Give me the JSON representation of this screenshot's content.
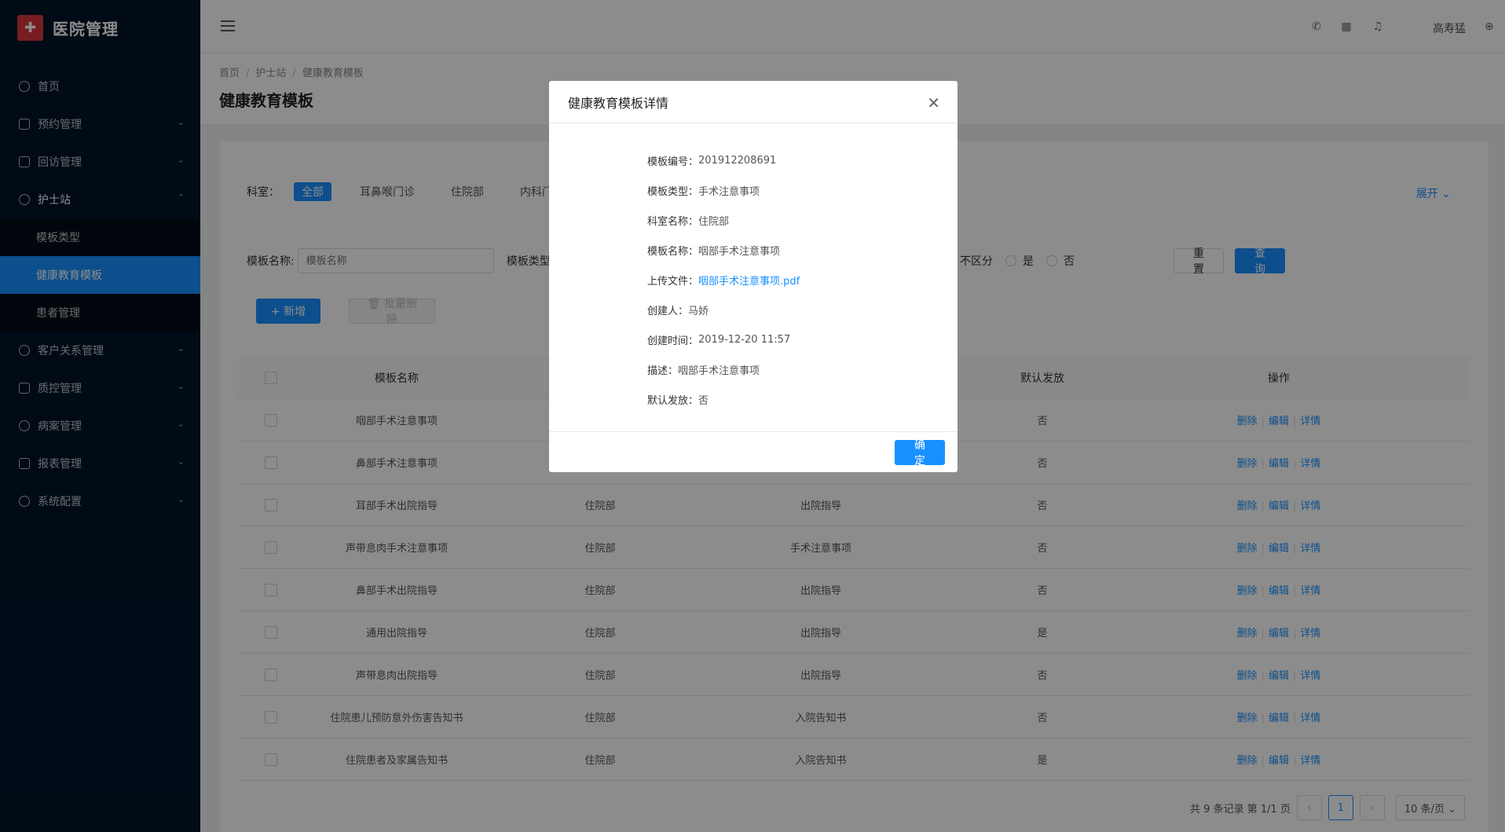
{
  "app": {
    "logo_glyph": "✚",
    "title": "医院管理"
  },
  "sidebar": {
    "items": [
      {
        "label": "首页",
        "icon": "dashboard-icon",
        "chevron": ""
      },
      {
        "label": "预约管理",
        "icon": "edit-icon",
        "chevron": "⌄"
      },
      {
        "label": "回访管理",
        "icon": "lock-icon",
        "chevron": "⌄"
      },
      {
        "label": "护士站",
        "icon": "user-icon",
        "chevron": "⌃"
      },
      {
        "label": "客户关系管理",
        "icon": "user-icon",
        "chevron": "⌄"
      },
      {
        "label": "质控管理",
        "icon": "table-icon",
        "chevron": "⌄"
      },
      {
        "label": "病案管理",
        "icon": "user-icon",
        "chevron": "⌄"
      },
      {
        "label": "报表管理",
        "icon": "edit-icon",
        "chevron": "⌄"
      },
      {
        "label": "系统配置",
        "icon": "dashboard-icon",
        "chevron": "⌄"
      }
    ],
    "sub_items": [
      {
        "label": "模板类型"
      },
      {
        "label": "健康教育模板"
      },
      {
        "label": "患者管理"
      }
    ]
  },
  "topbar": {
    "phone_glyph": "✆",
    "grid_glyph": "▦",
    "bell_glyph": "♫",
    "user": "高寿猛",
    "globe_glyph": "⊕"
  },
  "breadcrumb": {
    "items": [
      "首页",
      "护士站",
      "健康教育模板"
    ],
    "sep": "/"
  },
  "page_title": "健康教育模板",
  "filter": {
    "label": "科室：",
    "tags": [
      "全部",
      "耳鼻喉门诊",
      "住院部",
      "内科门诊"
    ],
    "expand": "展开 ⌄"
  },
  "search": {
    "name_label": "模板名称:",
    "name_placeholder": "模板名称",
    "type_label": "模板类型",
    "radio_label": "不区分",
    "radio_yes": "是",
    "radio_no": "否",
    "reset": "重 置",
    "query": "查 询"
  },
  "actions": {
    "add": "+ 新增",
    "batch_delete": "🗑 批量删除"
  },
  "table": {
    "headers": {
      "name": "模板名称",
      "dept": "",
      "type": "",
      "default": "默认发放",
      "op": "操作"
    },
    "op_labels": {
      "delete": "删除",
      "edit": "编辑",
      "detail": "详情",
      "sep": "|"
    },
    "rows": [
      {
        "name": "咽部手术注意事项",
        "dept": "",
        "type": "",
        "default": "否"
      },
      {
        "name": "鼻部手术注意事项",
        "dept": "",
        "type": "",
        "default": "否"
      },
      {
        "name": "耳部手术出院指导",
        "dept": "住院部",
        "type": "出院指导",
        "default": "否"
      },
      {
        "name": "声带息肉手术注意事项",
        "dept": "住院部",
        "type": "手术注意事项",
        "default": "否"
      },
      {
        "name": "鼻部手术出院指导",
        "dept": "住院部",
        "type": "出院指导",
        "default": "否"
      },
      {
        "name": "通用出院指导",
        "dept": "住院部",
        "type": "出院指导",
        "default": "是"
      },
      {
        "name": "声带息肉出院指导",
        "dept": "住院部",
        "type": "出院指导",
        "default": "否"
      },
      {
        "name": "住院患儿预防意外伤害告知书",
        "dept": "住院部",
        "type": "入院告知书",
        "default": "否"
      },
      {
        "name": "住院患者及家属告知书",
        "dept": "住院部",
        "type": "入院告知书",
        "default": "是"
      }
    ]
  },
  "pagination": {
    "summary": "共 9 条记录 第 1/1 页",
    "prev": "‹",
    "current": "1",
    "next": "›",
    "page_size": "10 条/页 ⌄"
  },
  "modal": {
    "title": "健康教育模板详情",
    "close": "✕",
    "fields": [
      {
        "k": "模板编号：",
        "v": "201912208691"
      },
      {
        "k": "模板类型：",
        "v": "手术注意事项"
      },
      {
        "k": "科室名称：",
        "v": "住院部"
      },
      {
        "k": "模板名称：",
        "v": "咽部手术注意事项"
      },
      {
        "k": "上传文件：",
        "v": "咽部手术注意事项.pdf"
      },
      {
        "k": "创建人：",
        "v": "马娇"
      },
      {
        "k": "创建时间：",
        "v": "2019-12-20 11:57"
      },
      {
        "k": "描述：",
        "v": "咽部手术注意事项"
      },
      {
        "k": "默认发放：",
        "v": "否"
      }
    ],
    "ok": "确 定"
  }
}
